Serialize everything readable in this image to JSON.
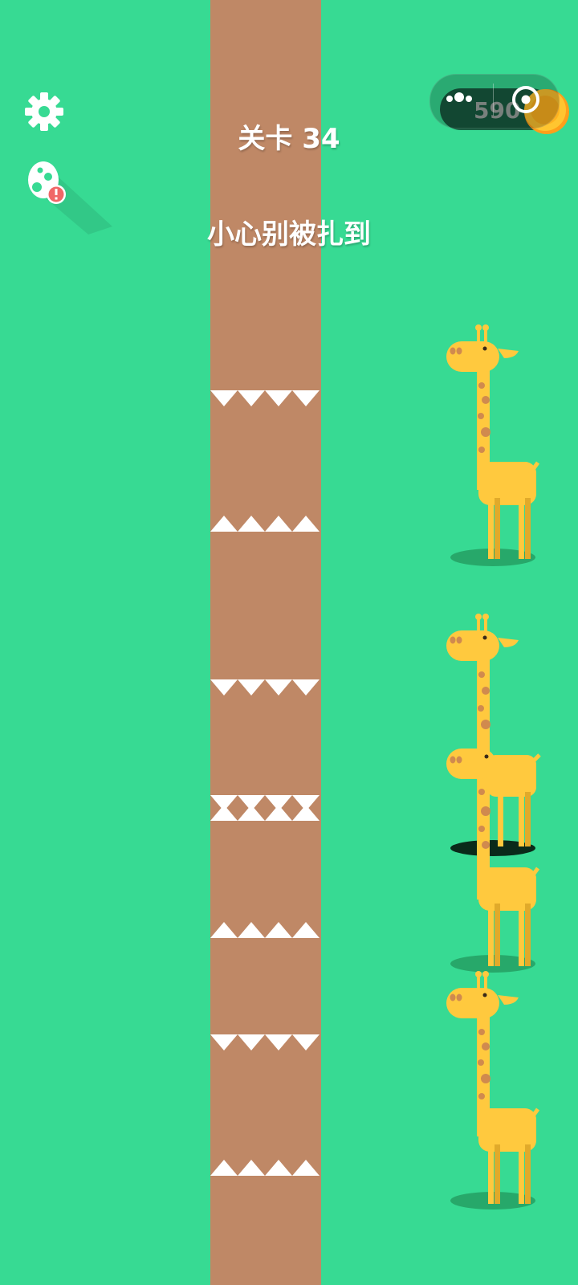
{
  "level": {
    "title": "关卡 34"
  },
  "hint": {
    "text": "小心别被扎到"
  },
  "coins": {
    "count": "590"
  },
  "icons": {
    "settings": "gear-icon",
    "egg": "egg-icon",
    "alert": "exclamation-badge-icon",
    "coin": "coin-icon",
    "menu": "more-dots-icon",
    "close": "target-circle-icon"
  },
  "colors": {
    "background": "#37da93",
    "column": "#bf8866",
    "giraffe": "#ffc93e",
    "spots": "#d08a4e",
    "spikes": "#ffffff"
  }
}
